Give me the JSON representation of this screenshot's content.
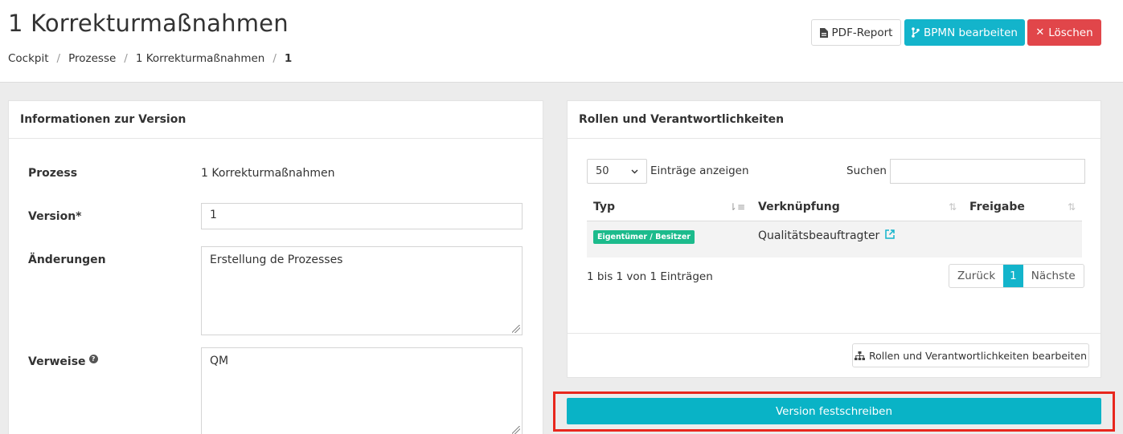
{
  "header": {
    "title": "1 Korrekturmaßnahmen",
    "breadcrumb": [
      "Cockpit",
      "Prozesse",
      "1 Korrekturmaßnahmen",
      "1"
    ],
    "buttons": {
      "pdf": {
        "label": "PDF-Report",
        "icon": "file-pdf-icon"
      },
      "bpmn": {
        "label": "BPMN bearbeiten",
        "icon": "branch-icon"
      },
      "delete": {
        "label": "Löschen",
        "icon": "close-icon"
      }
    }
  },
  "version_panel": {
    "title": "Informationen zur Version",
    "fields": {
      "prozess": {
        "label": "Prozess",
        "value": "1 Korrekturmaßnahmen"
      },
      "version": {
        "label": "Version*",
        "value": "1"
      },
      "aenderungen": {
        "label": "Änderungen",
        "value": "Erstellung de Prozesses"
      },
      "verweise": {
        "label": "Verweise",
        "value": "QM",
        "help_icon": "question-circle-icon"
      }
    }
  },
  "roles_panel": {
    "title": "Rollen und Verantwortlichkeiten",
    "page_length": "50",
    "page_length_suffix": "Einträge anzeigen",
    "search_label": "Suchen",
    "search_value": "",
    "columns": [
      "Typ",
      "Verknüpfung",
      "Freigabe"
    ],
    "rows": [
      {
        "typ": "Eigentümer / Besitzer",
        "verknuepfung": "Qualitätsbeauftragter",
        "freigabe": ""
      }
    ],
    "info": "1 bis 1 von 1 Einträgen",
    "pagination": {
      "prev": "Zurück",
      "current": "1",
      "next": "Nächste"
    },
    "edit_button": "Rollen und Verantwortlichkeiten bearbeiten"
  },
  "commit_button": "Version festschreiben",
  "colors": {
    "accent": "#13b4cb",
    "danger": "#e1464a",
    "badge": "#1cbb8c",
    "highlight": "#e8271d"
  }
}
